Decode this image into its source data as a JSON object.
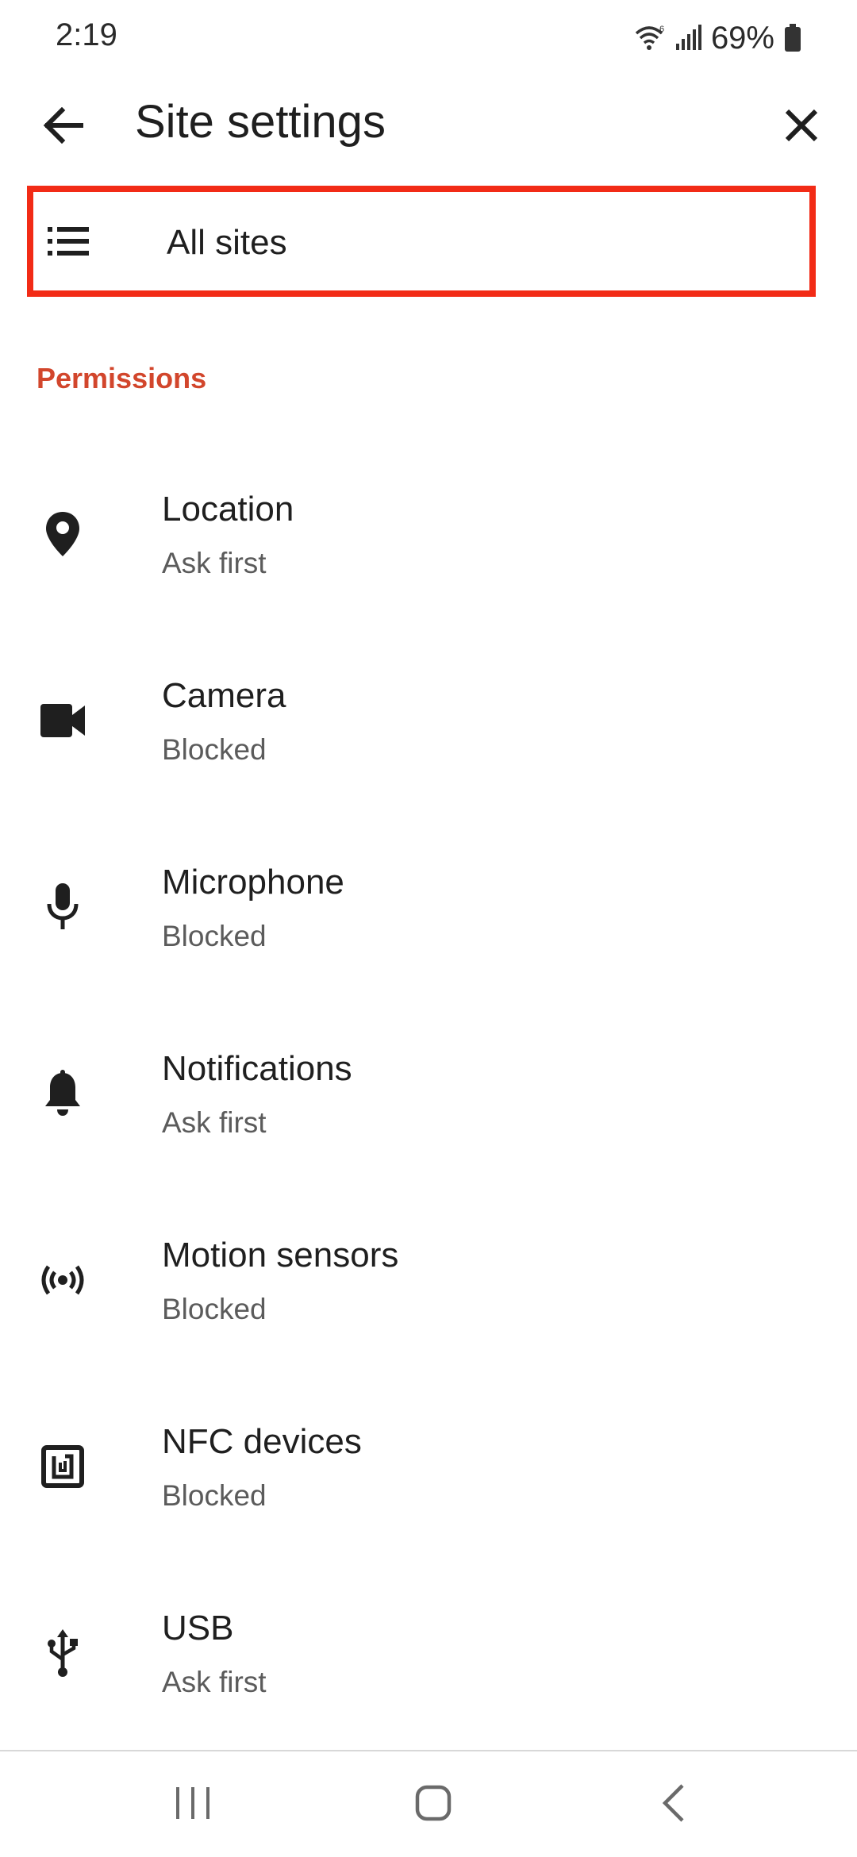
{
  "status_bar": {
    "time": "2:19",
    "battery": "69%",
    "icons": [
      "wifi-icon",
      "signal-icon",
      "battery-icon"
    ]
  },
  "app_bar": {
    "title": "Site settings",
    "back_icon": "arrow-back-icon",
    "close_icon": "close-icon"
  },
  "all_sites": {
    "label": "All sites",
    "icon": "list-icon",
    "highlight_color": "#f22b16"
  },
  "permissions": {
    "header": "Permissions",
    "header_color": "#d2462c",
    "items": [
      {
        "title": "Location",
        "status": "Ask first",
        "icon": "location-pin-icon"
      },
      {
        "title": "Camera",
        "status": "Blocked",
        "icon": "camera-icon"
      },
      {
        "title": "Microphone",
        "status": "Blocked",
        "icon": "microphone-icon"
      },
      {
        "title": "Notifications",
        "status": "Ask first",
        "icon": "bell-icon"
      },
      {
        "title": "Motion sensors",
        "status": "Blocked",
        "icon": "motion-sensors-icon"
      },
      {
        "title": "NFC devices",
        "status": "Blocked",
        "icon": "nfc-icon"
      },
      {
        "title": "USB",
        "status": "Ask first",
        "icon": "usb-icon"
      }
    ]
  },
  "nav_bar": {
    "icons": [
      "recents-icon",
      "home-icon",
      "nav-back-icon"
    ]
  }
}
